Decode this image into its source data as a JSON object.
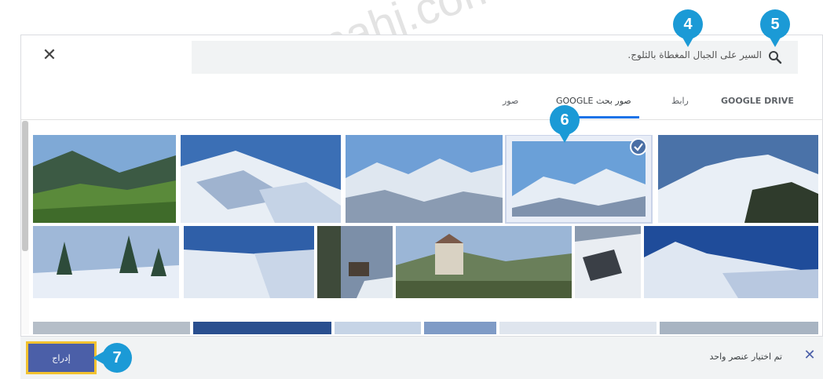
{
  "dialog": {
    "close_symbol": "✕",
    "search": {
      "value": "السير على الجبال المغطاة بالثلوج."
    },
    "tabs": [
      {
        "label": "GOOGLE DRIVE"
      },
      {
        "label": "رابط"
      },
      {
        "label": "صور بحث GOOGLE",
        "active": true
      },
      {
        "label": "صور"
      }
    ],
    "accent_color": "#1a73e8",
    "images": [
      {
        "name": "valley"
      },
      {
        "name": "snowy-slope-1"
      },
      {
        "name": "alps-panorama"
      },
      {
        "name": "snowy-mountain-selected",
        "selected": true
      },
      {
        "name": "snow-peaks"
      },
      {
        "name": "snowy-trees"
      },
      {
        "name": "snow-ridge"
      },
      {
        "name": "forest-cabin"
      },
      {
        "name": "castle"
      },
      {
        "name": "steep-slope"
      },
      {
        "name": "snow-plain"
      }
    ],
    "footer": {
      "insert_label": "إدراج",
      "status_text": "تم اختيار عنصر واحد",
      "dismiss_symbol": "✕"
    }
  },
  "callouts": [
    {
      "label": "4"
    },
    {
      "label": "5"
    },
    {
      "label": "6"
    },
    {
      "label": "7"
    }
  ],
  "watermark_text": "almanahj.com/sa"
}
